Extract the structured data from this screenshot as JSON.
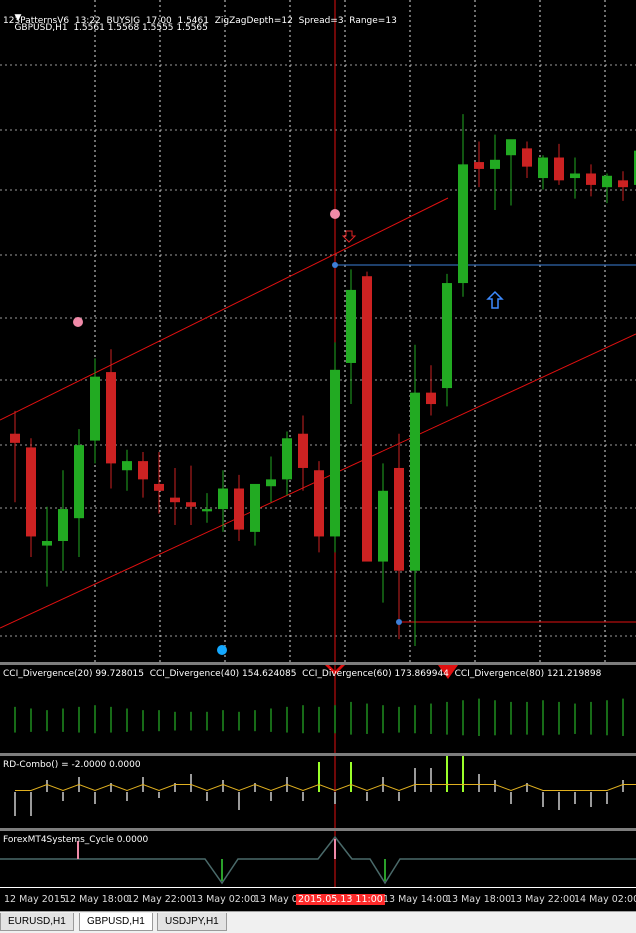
{
  "colors": {
    "bull": "#22aa22",
    "bear": "#cc2222",
    "grid": "#9a9a9a",
    "channel": "#e01010",
    "level": "#3d7fd8",
    "cci": "#1f8f1f",
    "combo": "#e0b020",
    "cycle": "#4a6a6a"
  },
  "main": {
    "symbol_line": "GBPUSD,H1  1.5561 1.5568 1.5555 1.5565",
    "info_line": "123PatternsV6  13:22  BUYSIG  17:00  1.5461  ZigZagDepth=12  Spread=3  Range=13",
    "icons": [
      "arrow-down-icon",
      "arrow-up-icon"
    ]
  },
  "cci": {
    "label": "CCI_Divergence(20) 99.728015  CCI_Divergence(40) 154.624085  CCI_Divergence(60) 173.869944  CCI_Divergence(80) 121.219898"
  },
  "rd": {
    "label": "RD-Combo() = -2.0000 0.0000"
  },
  "cycle": {
    "label": "ForexMT4Systems_Cycle 0.0000"
  },
  "time_axis": [
    {
      "text": "12 May 2015",
      "hl": false
    },
    {
      "text": "12 May 18:00",
      "hl": false
    },
    {
      "text": "12 May 22:00",
      "hl": false
    },
    {
      "text": "13 May 02:00",
      "hl": false
    },
    {
      "text": "13 May 0",
      "hl": false
    },
    {
      "text": "2015.05.13 11:00",
      "hl": true
    },
    {
      "text": "13 May 14:00",
      "hl": false
    },
    {
      "text": "13 May 18:00",
      "hl": false
    },
    {
      "text": "13 May 22:00",
      "hl": false
    },
    {
      "text": "14 May 02:00",
      "hl": false
    }
  ],
  "tabs": [
    {
      "label": "EURUSD,H1",
      "active": false
    },
    {
      "label": "GBPUSD,H1",
      "active": true
    },
    {
      "label": "USDJPY,H1",
      "active": false
    }
  ],
  "chart_data": {
    "type": "candlestick",
    "symbol": "GBPUSD",
    "timeframe": "H1",
    "candles": [
      {
        "o": 1.553,
        "h": 1.554,
        "l": 1.55,
        "c": 1.5526
      },
      {
        "o": 1.5524,
        "h": 1.5528,
        "l": 1.5476,
        "c": 1.5485
      },
      {
        "o": 1.5481,
        "h": 1.5498,
        "l": 1.5463,
        "c": 1.5483
      },
      {
        "o": 1.5483,
        "h": 1.5514,
        "l": 1.547,
        "c": 1.5497
      },
      {
        "o": 1.5493,
        "h": 1.5532,
        "l": 1.5476,
        "c": 1.5525
      },
      {
        "o": 1.5527,
        "h": 1.5563,
        "l": 1.5517,
        "c": 1.5555
      },
      {
        "o": 1.5557,
        "h": 1.5567,
        "l": 1.5506,
        "c": 1.5517
      },
      {
        "o": 1.5514,
        "h": 1.5523,
        "l": 1.5505,
        "c": 1.5518
      },
      {
        "o": 1.5518,
        "h": 1.5522,
        "l": 1.5502,
        "c": 1.551
      },
      {
        "o": 1.5508,
        "h": 1.5522,
        "l": 1.5495,
        "c": 1.5505
      },
      {
        "o": 1.5502,
        "h": 1.5515,
        "l": 1.549,
        "c": 1.55
      },
      {
        "o": 1.55,
        "h": 1.5516,
        "l": 1.549,
        "c": 1.5498
      },
      {
        "o": 1.5496,
        "h": 1.5504,
        "l": 1.5491,
        "c": 1.5497
      },
      {
        "o": 1.5497,
        "h": 1.5514,
        "l": 1.5487,
        "c": 1.5506
      },
      {
        "o": 1.5506,
        "h": 1.5512,
        "l": 1.5483,
        "c": 1.5488
      },
      {
        "o": 1.5487,
        "h": 1.5506,
        "l": 1.5481,
        "c": 1.5508
      },
      {
        "o": 1.5507,
        "h": 1.552,
        "l": 1.55,
        "c": 1.551
      },
      {
        "o": 1.551,
        "h": 1.5531,
        "l": 1.5503,
        "c": 1.5528
      },
      {
        "o": 1.553,
        "h": 1.5538,
        "l": 1.5505,
        "c": 1.5515
      },
      {
        "o": 1.5514,
        "h": 1.5518,
        "l": 1.5478,
        "c": 1.5485
      },
      {
        "o": 1.5485,
        "h": 1.557,
        "l": 1.5478,
        "c": 1.5558
      },
      {
        "o": 1.5561,
        "h": 1.5602,
        "l": 1.5543,
        "c": 1.5593
      },
      {
        "o": 1.5599,
        "h": 1.5601,
        "l": 1.5477,
        "c": 1.5474
      },
      {
        "o": 1.5474,
        "h": 1.5517,
        "l": 1.5456,
        "c": 1.5505
      },
      {
        "o": 1.5515,
        "h": 1.553,
        "l": 1.544,
        "c": 1.547
      },
      {
        "o": 1.547,
        "h": 1.5569,
        "l": 1.5437,
        "c": 1.5548
      },
      {
        "o": 1.5548,
        "h": 1.556,
        "l": 1.5538,
        "c": 1.5543
      },
      {
        "o": 1.555,
        "h": 1.56,
        "l": 1.5542,
        "c": 1.5596
      },
      {
        "o": 1.5596,
        "h": 1.567,
        "l": 1.559,
        "c": 1.5648
      },
      {
        "o": 1.5649,
        "h": 1.5658,
        "l": 1.5638,
        "c": 1.5646
      },
      {
        "o": 1.5646,
        "h": 1.5661,
        "l": 1.5628,
        "c": 1.565
      },
      {
        "o": 1.5652,
        "h": 1.5655,
        "l": 1.563,
        "c": 1.5659
      },
      {
        "o": 1.5655,
        "h": 1.5658,
        "l": 1.5642,
        "c": 1.5647
      },
      {
        "o": 1.5642,
        "h": 1.5652,
        "l": 1.5637,
        "c": 1.5651
      },
      {
        "o": 1.5651,
        "h": 1.5657,
        "l": 1.5639,
        "c": 1.5641
      },
      {
        "o": 1.5642,
        "h": 1.5651,
        "l": 1.5633,
        "c": 1.5644
      },
      {
        "o": 1.5644,
        "h": 1.5648,
        "l": 1.5634,
        "c": 1.5639
      },
      {
        "o": 1.5638,
        "h": 1.5644,
        "l": 1.5631,
        "c": 1.5643
      },
      {
        "o": 1.5641,
        "h": 1.5645,
        "l": 1.5632,
        "c": 1.5638
      },
      {
        "o": 1.5639,
        "h": 1.5656,
        "l": 1.5636,
        "c": 1.5654
      },
      {
        "o": 1.5654,
        "h": 1.5658,
        "l": 1.5636,
        "c": 1.5638
      },
      {
        "o": 1.5638,
        "h": 1.567,
        "l": 1.5636,
        "c": 1.5663
      }
    ],
    "cci_bars": [
      0.55,
      0.5,
      0.45,
      0.5,
      0.55,
      0.6,
      0.55,
      0.5,
      0.45,
      0.45,
      0.4,
      0.4,
      0.4,
      0.45,
      0.4,
      0.45,
      0.5,
      0.55,
      0.6,
      0.55,
      0.6,
      0.7,
      0.65,
      0.6,
      0.55,
      0.6,
      0.65,
      0.7,
      0.75,
      0.8,
      0.75,
      0.7,
      0.7,
      0.75,
      0.7,
      0.65,
      0.7,
      0.75,
      0.8,
      0.8,
      0.75,
      0.7
    ],
    "rd_bars": [
      -0.8,
      -0.8,
      0.4,
      -0.3,
      0.5,
      -0.4,
      0.3,
      -0.3,
      0.5,
      -0.2,
      0.3,
      0.6,
      -0.3,
      0.4,
      -0.6,
      0.3,
      -0.3,
      0.5,
      -0.3,
      1.0,
      -0.4,
      1.0,
      -0.3,
      0.5,
      -0.3,
      0.8,
      0.8,
      1.2,
      1.2,
      0.6,
      0.4,
      -0.4,
      0.3,
      -0.5,
      -0.6,
      -0.4,
      -0.5,
      -0.4,
      0.4,
      0.3,
      0.3,
      -0.3
    ]
  }
}
